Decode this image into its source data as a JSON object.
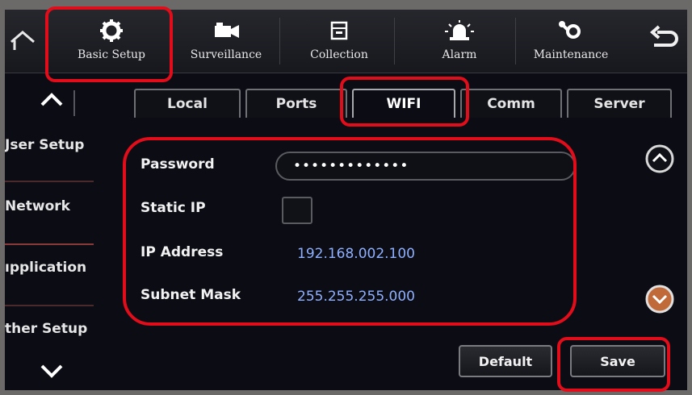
{
  "toolbar": {
    "items": [
      {
        "label": "Basic Setup",
        "icon": "gear-icon"
      },
      {
        "label": "Surveillance",
        "icon": "camera-icon"
      },
      {
        "label": "Collection",
        "icon": "storage-icon"
      },
      {
        "label": "Alarm",
        "icon": "alarm-light-icon"
      },
      {
        "label": "Maintenance",
        "icon": "tools-icon"
      }
    ],
    "home_icon": "home-icon",
    "back_icon": "back-arrow-icon"
  },
  "tabs": [
    {
      "label": "Local"
    },
    {
      "label": "Ports"
    },
    {
      "label": "WIFI"
    },
    {
      "label": "Comm"
    },
    {
      "label": "Server"
    }
  ],
  "active_tab": "WIFI",
  "sidebar": {
    "items": [
      {
        "label": "Jser Setup"
      },
      {
        "label": "Network"
      },
      {
        "label": "ıpplication"
      },
      {
        "label": "ther Setup"
      }
    ]
  },
  "form": {
    "password_label": "Password",
    "password_value": "•••••••••••••",
    "static_ip_label": "Static IP",
    "ip_label": "IP Address",
    "ip_value": "192.168.002.100",
    "subnet_label": "Subnet Mask",
    "subnet_value": "255.255.255.000"
  },
  "buttons": {
    "default_label": "Default",
    "save_label": "Save"
  },
  "colors": {
    "highlight": "#e10d1a",
    "value_text": "#8fb0ff",
    "background": "#0c0d14"
  }
}
